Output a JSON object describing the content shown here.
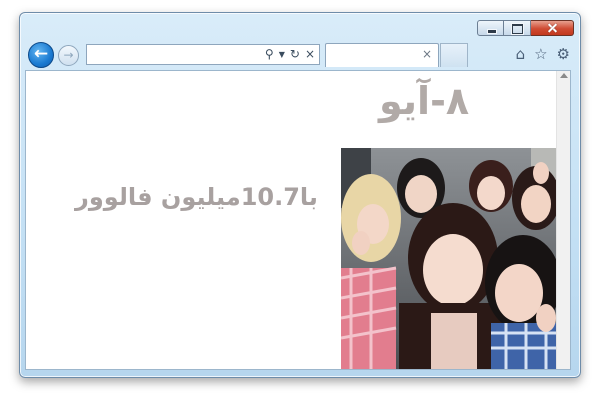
{
  "browser": {
    "address_value": "",
    "address_placeholder": "",
    "tab_title": "",
    "close_glyph": "×",
    "controls": {
      "back_icon": "back-arrow-icon",
      "forward_icon": "forward-arrow-icon",
      "search_icon": "search-icon",
      "refresh_icon": "refresh-icon",
      "stop_icon": "stop-icon",
      "home_icon": "home-icon",
      "favorites_icon": "star-icon",
      "tools_icon": "gear-icon"
    }
  },
  "page": {
    "headline": "۸-آیو",
    "subline": "با10.7میلیون فالوور",
    "text_color": "#b1aaa7"
  }
}
